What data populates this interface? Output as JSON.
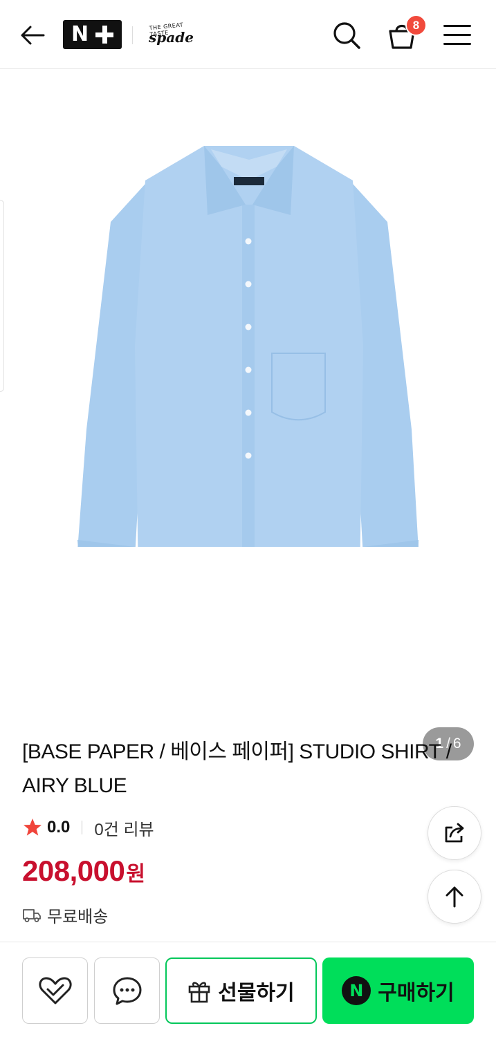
{
  "header": {
    "logo_text": "N",
    "brand_tagline": "THE GREAT TASTE",
    "brand_name": "spade",
    "cart_count": "8",
    "icons": [
      "back-arrow-icon",
      "search-icon",
      "shopping-bag-icon",
      "hamburger-menu-icon"
    ]
  },
  "gallery": {
    "current": "1",
    "total": "6",
    "separator": "/",
    "image_subject": "light blue button-up shirt"
  },
  "product": {
    "title": "[BASE PAPER / 베이스 페이퍼] STUDIO SHIRT / AIRY BLUE",
    "rating": "0.0",
    "review_count_text": "0건 리뷰",
    "price": "208,000",
    "price_unit": "원",
    "shipping": "무료배송"
  },
  "bottom_bar": {
    "gift_label": "선물하기",
    "buy_label": "구매하기",
    "npay_mark": "N"
  },
  "colors": {
    "price_red": "#c8102e",
    "naver_green": "#00de5a",
    "star_red": "#f0443a",
    "badge_red": "#f14a3c",
    "shirt_blue": "#a9cdef"
  }
}
